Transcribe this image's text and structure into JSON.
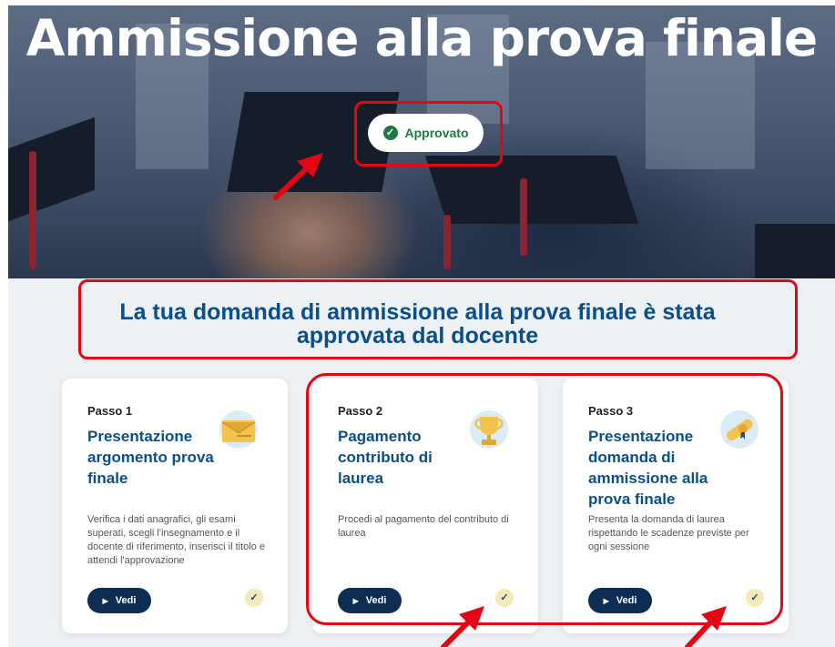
{
  "hero": {
    "title": "Ammissione alla prova finale",
    "status_label": "Approvato"
  },
  "headline": {
    "line1": "La tua domanda di ammissione alla prova finale è stata",
    "line2": "approvata dal docente"
  },
  "cards": [
    {
      "step": "Passo 1",
      "title": "Presentazione argomento prova finale",
      "description": "Verifica i dati anagrafici, gli esami superati, scegli l'insegnamento e il docente di riferimento, inserisci il titolo e attendi l'approvazione",
      "button": "Vedi",
      "icon": "envelope-icon"
    },
    {
      "step": "Passo 2",
      "title": "Pagamento contributo di laurea",
      "description": "Procedi al pagamento del contributo di laurea",
      "button": "Vedi",
      "icon": "trophy-icon"
    },
    {
      "step": "Passo 3",
      "title": "Presentazione domanda di ammissione alla prova finale",
      "description": "Presenta la domanda di laurea rispettando le scadenze previste per ogni sessione",
      "button": "Vedi",
      "icon": "diploma-icon"
    }
  ],
  "colors": {
    "brand": "#0b4f8a",
    "button": "#0d2d52",
    "success": "#1f7a3e",
    "annotation": "#e40613",
    "background": "#edf1f4"
  }
}
